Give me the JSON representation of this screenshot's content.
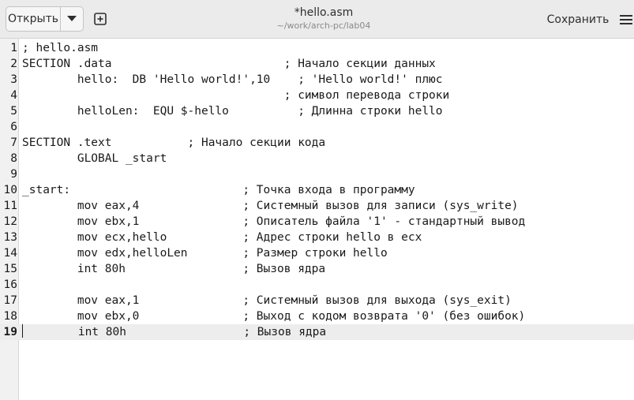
{
  "header": {
    "open_label": "Открыть",
    "save_label": "Сохранить",
    "title": "*hello.asm",
    "subtitle": "~/work/arch-pc/lab04"
  },
  "icons": {
    "open_dropdown": "chevron-down-icon",
    "new_tab": "new-tab-plus-icon",
    "menu": "hamburger-menu-icon"
  },
  "editor": {
    "current_line": 19,
    "lines": [
      {
        "num": "1",
        "text": "; hello.asm"
      },
      {
        "num": "2",
        "text": "SECTION .data                         ; Начало секции данных"
      },
      {
        "num": "3",
        "text": "        hello:  DB 'Hello world!',10    ; 'Hello world!' плюс"
      },
      {
        "num": "4",
        "text": "                                      ; символ перевода строки"
      },
      {
        "num": "5",
        "text": "        helloLen:  EQU $-hello          ; Длинна строки hello"
      },
      {
        "num": "6",
        "text": ""
      },
      {
        "num": "7",
        "text": "SECTION .text           ; Начало секции кода"
      },
      {
        "num": "8",
        "text": "        GLOBAL _start"
      },
      {
        "num": "9",
        "text": ""
      },
      {
        "num": "10",
        "text": "_start:                         ; Точка входа в программу"
      },
      {
        "num": "11",
        "text": "        mov eax,4               ; Системный вызов для записи (sys_write)"
      },
      {
        "num": "12",
        "text": "        mov ebx,1               ; Описатель файла '1' - стандартный вывод"
      },
      {
        "num": "13",
        "text": "        mov ecx,hello           ; Адрес строки hello в ecx"
      },
      {
        "num": "14",
        "text": "        mov edx,helloLen        ; Размер строки hello"
      },
      {
        "num": "15",
        "text": "        int 80h                 ; Вызов ядра"
      },
      {
        "num": "16",
        "text": ""
      },
      {
        "num": "17",
        "text": "        mov eax,1               ; Системный вызов для выхода (sys_exit)"
      },
      {
        "num": "18",
        "text": "        mov ebx,0               ; Выход с кодом возврата '0' (без ошибок)"
      },
      {
        "num": "19",
        "text": "        int 80h                 ; Вызов ядра"
      }
    ]
  },
  "colors": {
    "headerbar": "#ebebeb",
    "gutter": "#f1f1f1",
    "current_line": "#ededed",
    "text": "#1a1a1a"
  }
}
